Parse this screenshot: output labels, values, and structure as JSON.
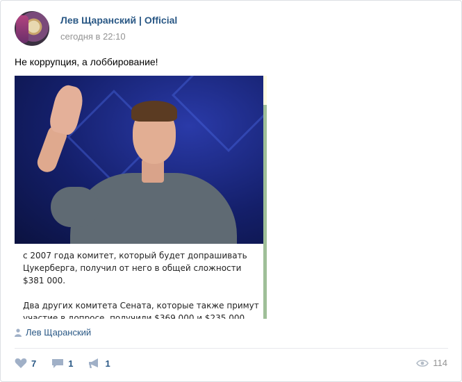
{
  "post": {
    "author": "Лев Щаранский | Official",
    "time": "сегодня в 22:10",
    "text": "Не коррупция, а лоббирование!",
    "image_caption": {
      "paragraph1": "с 2007 года комитет, который будет допрашивать Цукерберга, получил от него в общей сложности $381 000.",
      "paragraph2": "Два других комитета Сената, которые также примут участие в допросе, получили $369 000 и $235 000"
    },
    "signer": "Лев Щаранский"
  },
  "footer": {
    "likes": "7",
    "comments": "1",
    "reposts": "1",
    "views": "114"
  },
  "icons": {
    "like": "heart-icon",
    "comment": "comment-icon",
    "repost": "megaphone-icon",
    "views": "eye-icon",
    "signer": "person-icon"
  },
  "colors": {
    "link": "#2a5885",
    "muted": "#939393",
    "icon": "#a0b0c7"
  }
}
